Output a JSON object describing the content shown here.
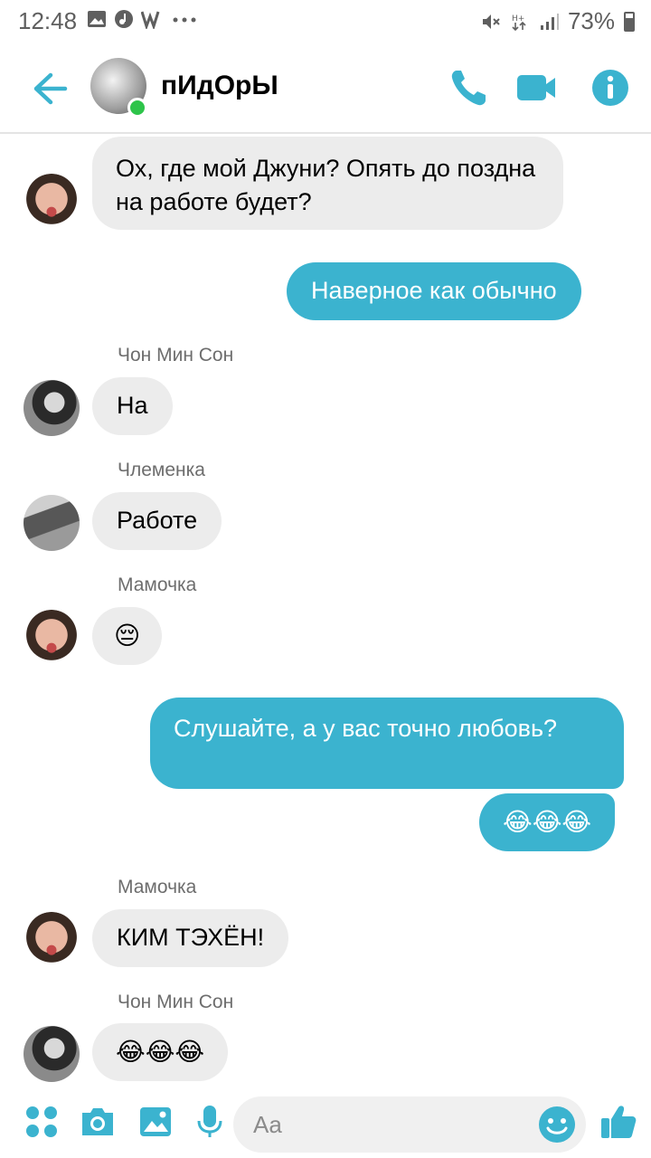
{
  "status_bar": {
    "time": "12:48",
    "battery": "73%",
    "battery_level": 0.73,
    "left_icons": [
      "gallery-icon",
      "music-icon",
      "w-app-icon",
      "more-dots-icon"
    ],
    "right_icons": [
      "mute-icon",
      "data-icon",
      "signal-icon",
      "battery-icon"
    ]
  },
  "header": {
    "title": "пИдОрЫ",
    "online": true,
    "actions": [
      "phone-icon",
      "video-icon",
      "info-icon"
    ],
    "accent": "#3bb3cf"
  },
  "messages": [
    {
      "side": "in",
      "sender": "",
      "avatar": "mom",
      "text": "Ох, где мой Джуни? Опять до поздна на работе будет?"
    },
    {
      "side": "out",
      "text": "Наверное как обычно"
    },
    {
      "side": "in",
      "sender": "Чон Мин Сон",
      "avatar": "chon",
      "text": "На"
    },
    {
      "side": "in",
      "sender": "Члеменка",
      "avatar": "chlem",
      "text": "Работе"
    },
    {
      "side": "in",
      "sender": "Мамочка",
      "avatar": "mom",
      "text": "😔"
    },
    {
      "side": "out",
      "text": "Слушайте, а у вас точно любовь?"
    },
    {
      "side": "out",
      "text": "😂😂😂"
    },
    {
      "side": "in",
      "sender": "Мамочка",
      "avatar": "mom",
      "text": "КИМ ТЭХЁН!"
    },
    {
      "side": "in",
      "sender": "Чон Мин Сон",
      "avatar": "chon",
      "text": "😂😂😂"
    }
  ],
  "composer": {
    "placeholder": "Aa",
    "icons": [
      "menu-dots-icon",
      "camera-icon",
      "image-icon",
      "mic-icon",
      "emoji-icon",
      "thumbs-up-icon"
    ]
  },
  "colors": {
    "outgoing_bubble": "#3bb3cf",
    "incoming_bubble": "#ececec",
    "online": "#2ec44a"
  }
}
